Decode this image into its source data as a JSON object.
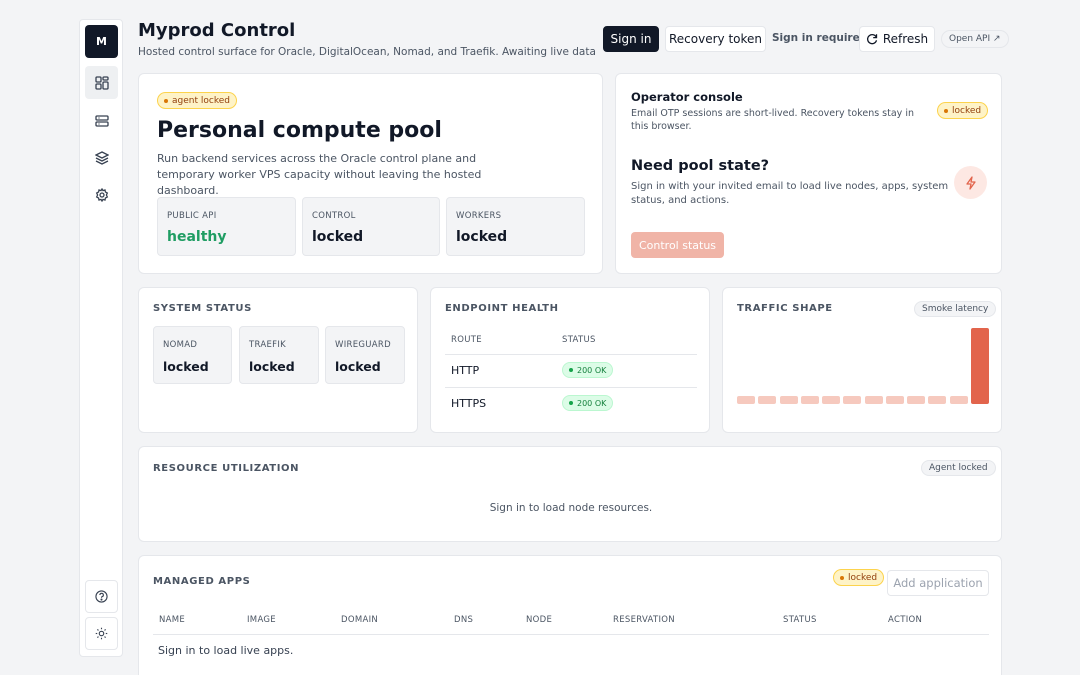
{
  "sidebar": {
    "logo": "M",
    "items": [
      {
        "icon": "dashboard-icon"
      },
      {
        "icon": "servers-icon"
      },
      {
        "icon": "layers-icon"
      },
      {
        "icon": "gear-icon"
      }
    ],
    "footer": [
      {
        "icon": "help-icon"
      },
      {
        "icon": "sun-icon"
      }
    ]
  },
  "header": {
    "title": "Myprod Control",
    "subtitle": "Hosted control surface for Oracle, DigitalOcean, Nomad, and Traefik. Awaiting live data",
    "sign_in": "Sign in",
    "recovery_token": "Recovery token",
    "sign_in_required": "Sign in required",
    "refresh": "Refresh",
    "open_api": "Open API ↗"
  },
  "hero": {
    "badge": "agent locked",
    "title": "Personal compute pool",
    "description": "Run backend services across the Oracle control plane and temporary worker VPS capacity without leaving the hosted dashboard.",
    "stats": [
      {
        "label": "PUBLIC API",
        "value": "healthy",
        "color": "#1f9d63"
      },
      {
        "label": "CONTROL",
        "value": "locked",
        "color": "#111827"
      },
      {
        "label": "WORKERS",
        "value": "locked",
        "color": "#111827"
      }
    ]
  },
  "operator": {
    "title": "Operator console",
    "description": "Email OTP sessions are short-lived. Recovery tokens stay in this browser.",
    "badge": "locked",
    "cta_title": "Need pool state?",
    "cta_description": "Sign in with your invited email to load live nodes, apps, system status, and actions.",
    "cta_button": "Control status",
    "accent": "#e2644c"
  },
  "system_status": {
    "title": "SYSTEM STATUS",
    "items": [
      {
        "label": "NOMAD",
        "value": "locked"
      },
      {
        "label": "TRAEFIK",
        "value": "locked"
      },
      {
        "label": "WIREGUARD",
        "value": "locked"
      }
    ]
  },
  "endpoint_health": {
    "title": "ENDPOINT HEALTH",
    "columns": [
      "ROUTE",
      "STATUS"
    ],
    "rows": [
      {
        "route": "HTTP",
        "status": "200 OK"
      },
      {
        "route": "HTTPS",
        "status": "200 OK"
      }
    ]
  },
  "traffic": {
    "title": "TRAFFIC SHAPE",
    "badge": "Smoke latency",
    "bars": [
      0.1,
      0.1,
      0.1,
      0.1,
      0.1,
      0.1,
      0.1,
      0.1,
      0.1,
      0.1,
      0.1,
      1.0
    ],
    "bar_color": "#f6c9be",
    "peak_color": "#e2644c"
  },
  "resource": {
    "title": "RESOURCE UTILIZATION",
    "badge": "Agent locked",
    "empty": "Sign in to load node resources."
  },
  "apps": {
    "title": "MANAGED APPS",
    "badge": "locked",
    "add_button": "Add application",
    "columns": [
      "NAME",
      "IMAGE",
      "DOMAIN",
      "DNS",
      "NODE",
      "RESERVATION",
      "STATUS",
      "ACTION"
    ],
    "empty": "Sign in to load live apps."
  }
}
